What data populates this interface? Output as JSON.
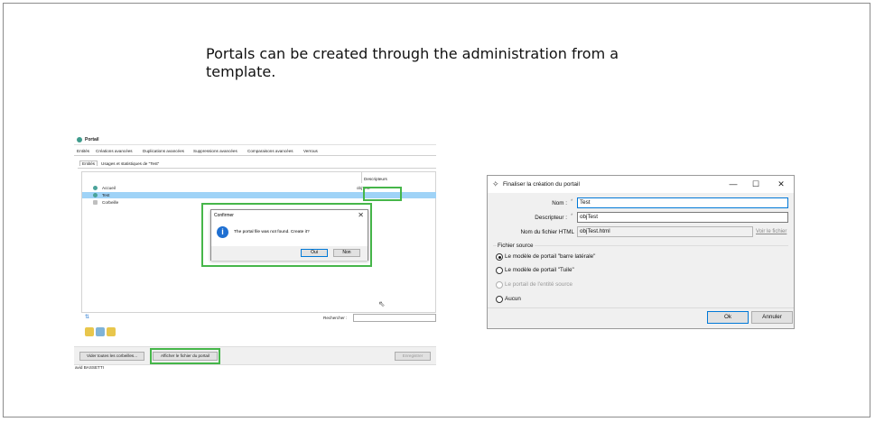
{
  "caption": "Portals can be created through the administration from a template.",
  "left_app": {
    "title": "Portail",
    "tabs": [
      "Entités",
      "Créations avancées",
      "Duplications avancées",
      "Suppressions avancées",
      "Comparaisons avancées",
      "Verrous"
    ],
    "subtabs": [
      "Entités",
      "Usages et statistiques de \"Test\""
    ],
    "column_header": "Descripteurs",
    "tree_items": [
      "Accueil",
      "Test",
      "Corbeille"
    ],
    "descriptor_value": "objTest",
    "search_label": "Rechercher :",
    "buttons": {
      "empty_bins": "Vider toutes les corbeilles...",
      "show_portal_file": "Afficher le fichier du portail",
      "save": "Enregistrer"
    },
    "status_user": "avid BASSETTI",
    "confirm_dialog": {
      "title": "Confirmer",
      "message": "The portal file was not found. Create it?",
      "yes": "Oui",
      "no": "Non",
      "close": "✕"
    }
  },
  "right_dialog": {
    "title": "Finaliser la création du portail",
    "minimize": "—",
    "maximize": "☐",
    "close": "✕",
    "name_label": "Nom :",
    "name_value": "Test",
    "descriptor_label": "Descripteur :",
    "descriptor_value": "objTest",
    "html_label": "Nom du fichier HTML",
    "html_value": "objTest.html",
    "view_file_link": "Voir le fichier",
    "required_mark": "*",
    "source_group": "Fichier source",
    "options": [
      "Le modèle de portail \"barre latérale\"",
      "Le modèle de portail \"Tuile\"",
      "Le portail de l'entité source",
      "Aucun"
    ],
    "ok": "Ok",
    "cancel": "Annuler"
  }
}
